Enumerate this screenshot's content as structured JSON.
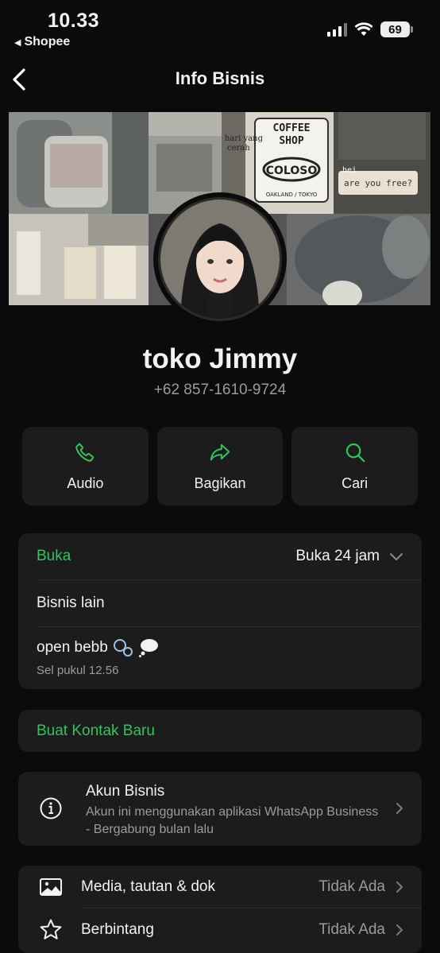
{
  "status_bar": {
    "time": "10.33",
    "back_app": "Shopee",
    "battery": "69"
  },
  "header": {
    "title": "Info Bisnis"
  },
  "profile": {
    "name": "toko Jimmy",
    "phone": "+62 857-1610-9724"
  },
  "actions": [
    {
      "label": "Audio",
      "icon": "phone-icon"
    },
    {
      "label": "Bagikan",
      "icon": "share-icon"
    },
    {
      "label": "Cari",
      "icon": "search-icon"
    }
  ],
  "hours": {
    "label": "Buka",
    "value": "Buka 24 jam"
  },
  "other_business": "Bisnis lain",
  "status": {
    "text": "open bebb",
    "time": "Sel pukul 12.56"
  },
  "new_contact": "Buat Kontak Baru",
  "account": {
    "title": "Akun Bisnis",
    "description": "Akun ini menggunakan aplikasi WhatsApp Business - Bergabung bulan lalu"
  },
  "media": {
    "label": "Media, tautan & dok",
    "value": "Tidak Ada"
  },
  "starred": {
    "label": "Berbintang",
    "value": "Tidak Ada"
  },
  "colors": {
    "accent": "#33c25e",
    "card": "#1c1c1c",
    "background": "#0b0b0b"
  }
}
